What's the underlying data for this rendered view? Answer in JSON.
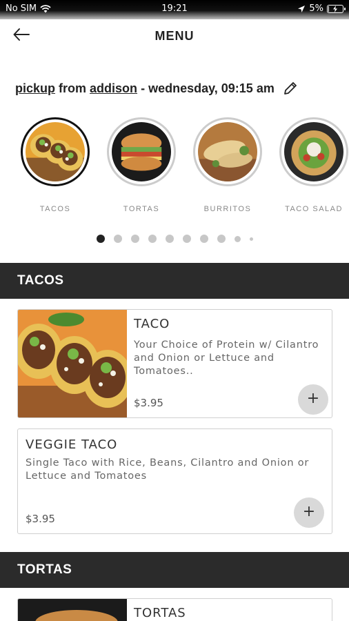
{
  "status_bar": {
    "carrier": "No SIM",
    "wifi_icon": "wifi-icon",
    "time": "19:21",
    "location_icon": "location-arrow-icon",
    "battery_percent": "5%",
    "battery_level": 0.05
  },
  "header": {
    "back_icon": "arrow-left-icon",
    "title": "MENU"
  },
  "order_info": {
    "mode": "pickup",
    "from_text": "from",
    "location": "addison",
    "schedule": "- wednesday, 09:15 am",
    "edit_icon": "pencil-icon"
  },
  "categories": [
    {
      "label": "TACOS",
      "selected": true
    },
    {
      "label": "TORTAS",
      "selected": false
    },
    {
      "label": "BURRITOS",
      "selected": false
    },
    {
      "label": "TACO SALAD",
      "selected": false
    }
  ],
  "pager": {
    "count": 10,
    "active_index": 0
  },
  "sections": [
    {
      "title": "TACOS",
      "items": [
        {
          "name": "TACO",
          "description": "Your Choice of Protein w/ Cilantro and Onion or Lettuce and Tomatoes..",
          "price": "$3.95",
          "has_image": true
        },
        {
          "name": "VEGGIE TACO",
          "description": "Single Taco with Rice, Beans, Cilantro and Onion or Lettuce and Tomatoes",
          "price": "$3.95",
          "has_image": false
        }
      ]
    },
    {
      "title": "TORTAS",
      "items": [
        {
          "name": "TORTAS",
          "has_image": true
        }
      ]
    }
  ],
  "add_button_symbol": "+",
  "colors": {
    "section_bar": "#2b2b2b",
    "active_ring": "#111111",
    "inactive_ring": "#cccccc",
    "add_button": "#d9d9d9"
  }
}
